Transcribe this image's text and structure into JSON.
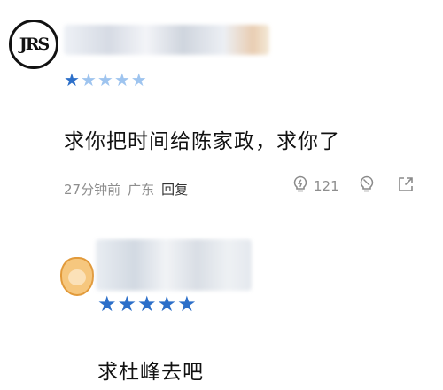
{
  "comments": [
    {
      "avatar_text": "JRS",
      "rating": 1,
      "max_rating": 5,
      "text": "求你把时间给陈家政，求你了",
      "time": "27分钟前",
      "location": "广东",
      "reply_label": "回复",
      "like_count": "121"
    },
    {
      "avatar_icon": "tiger-avatar-icon",
      "rating": 5,
      "max_rating": 5,
      "text": "求杜峰去吧"
    }
  ],
  "icons": {
    "like": "lightbulb-like-icon",
    "dislike": "lightbulb-dislike-icon",
    "share": "share-icon",
    "star": "star-icon"
  },
  "colors": {
    "star_active": "#2c6fc9",
    "star_inactive": "#9ec4ef",
    "meta_text": "#8e8e8e"
  }
}
